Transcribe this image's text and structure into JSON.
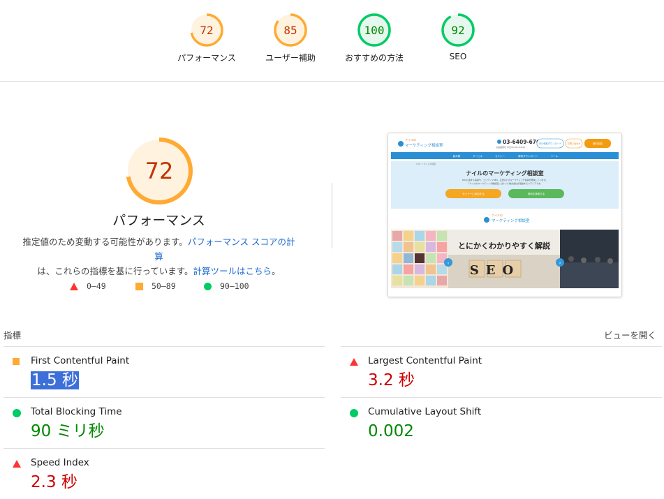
{
  "categories": [
    {
      "label": "パフォーマンス",
      "score": "72",
      "fraction": 0.72,
      "color": "#fa3",
      "fill": "#fff3e0",
      "text_color": "#c33300"
    },
    {
      "label": "ユーザー補助",
      "score": "85",
      "fraction": 0.85,
      "color": "#fa3",
      "fill": "#fff3e0",
      "text_color": "#c33300"
    },
    {
      "label": "おすすめの方法",
      "score": "100",
      "fraction": 1.0,
      "color": "#0c6",
      "fill": "#e6f7ee",
      "text_color": "#008800"
    },
    {
      "label": "SEO",
      "score": "92",
      "fraction": 0.92,
      "color": "#0c6",
      "fill": "#e6f7ee",
      "text_color": "#008800"
    }
  ],
  "performance": {
    "score": "72",
    "fraction": 0.72,
    "title": "パフォーマンス",
    "desc_1": "推定値のため変動する可能性があります。",
    "desc_link_1": "パフォーマンス スコアの計算",
    "desc_2": "は、これらの指標を基に行っています。",
    "desc_link_2": "計算ツールはこちら",
    "desc_3": "。"
  },
  "legend": {
    "fail": "0–49",
    "average": "50–89",
    "pass": "90–100"
  },
  "screenshot": {
    "logo_small": "ナイルの",
    "logo_main": "マーケティング相談室",
    "phone": "03-6409-6766",
    "phone_sub": "お電話受付 平日10:00〜18:00",
    "btn1": "SEO資料ダウンロード",
    "btn2": "お問い合わせ",
    "btn3": "無料相談",
    "nav": [
      "読み物",
      "サービス",
      "セミナー",
      "資料ダウンロード",
      "ツール"
    ],
    "breadcrumb": "TOP > サイト内検索",
    "hero_title": "ナイルのマーケティング相談室",
    "hero_sub1": "SEOに関する情報や、コンテンツSEO、広告などのマーケティング情報を発信しています。",
    "hero_sub2": "「ナイルのマーケティング相談室」はナイル株式会社が運営するメディアです。",
    "hero_btn1": "セミナーに参加する",
    "hero_btn2": "資料を請求する",
    "banner_title": "とにかくわかりやすく解説",
    "banner_seo": "SEO"
  },
  "metrics": {
    "header": "指標",
    "expand": "ビューを開く",
    "items": [
      {
        "title": "First Contentful Paint",
        "value": "1.5 秒",
        "rating": "average"
      },
      {
        "title": "Largest Contentful Paint",
        "value": "3.2 秒",
        "rating": "fail"
      },
      {
        "title": "Total Blocking Time",
        "value": "90 ミリ秒",
        "rating": "pass"
      },
      {
        "title": "Cumulative Layout Shift",
        "value": "0.002",
        "rating": "pass"
      },
      {
        "title": "Speed Index",
        "value": "2.3 秒",
        "rating": "fail"
      }
    ]
  }
}
